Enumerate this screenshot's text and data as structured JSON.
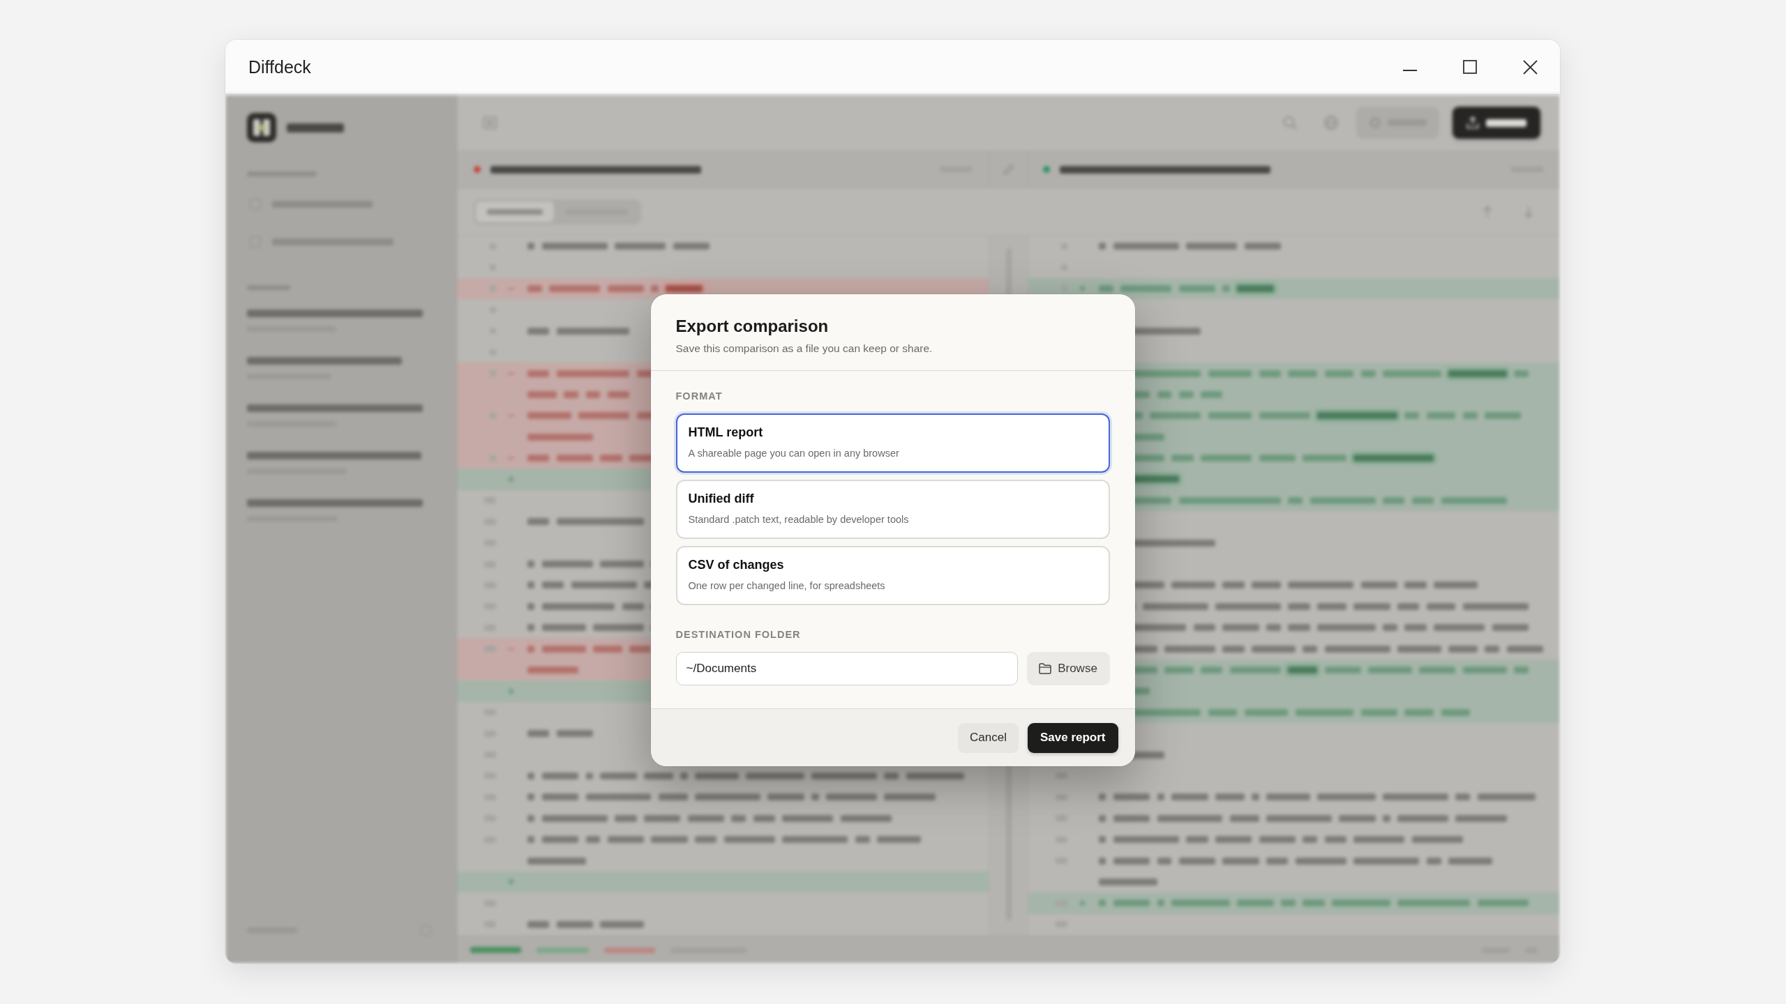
{
  "window": {
    "title": "Diffdeck"
  },
  "dialog": {
    "title": "Export comparison",
    "subtitle": "Save this comparison as a file you can keep or share.",
    "format_label": "FORMAT",
    "formats": [
      {
        "title": "HTML report",
        "description": "A shareable page you can open in any browser",
        "selected": true
      },
      {
        "title": "Unified diff",
        "description": "Standard .patch text, readable by developer tools",
        "selected": false
      },
      {
        "title": "CSV of changes",
        "description": "One row per changed line, for spreadsheets",
        "selected": false
      }
    ],
    "destination_label": "DESTINATION FOLDER",
    "destination_value": "~/Documents",
    "browse_button": "Browse",
    "cancel_button": "Cancel",
    "save_button": "Save report"
  }
}
